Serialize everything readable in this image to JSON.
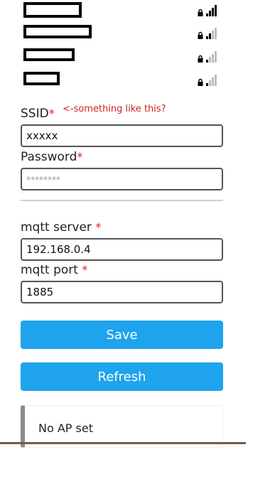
{
  "networks": [
    {
      "name": "",
      "signal_bars_on": 4,
      "signal_bars_total": 4,
      "locked": true
    },
    {
      "name": "",
      "signal_bars_on": 2,
      "signal_bars_total": 4,
      "locked": true
    },
    {
      "name": "",
      "signal_bars_on": 1,
      "signal_bars_total": 4,
      "locked": true
    },
    {
      "name": "",
      "signal_bars_on": 1,
      "signal_bars_total": 4,
      "locked": true
    }
  ],
  "form": {
    "ssid_label": "SSID",
    "ssid_value": "xxxxx",
    "ssid_annotation": "<-something like this?",
    "password_label": "Password",
    "password_placeholder": "********",
    "mqtt_server_label": "mqtt server",
    "mqtt_server_value": "192.168.0.4",
    "mqtt_port_label": "mqtt port",
    "mqtt_port_value": "1885",
    "required_marker": "*"
  },
  "buttons": {
    "save_label": "Save",
    "refresh_label": "Refresh"
  },
  "status": {
    "message": "No AP set"
  },
  "colors": {
    "button": "#1fa3ec",
    "required": "#e01b1b",
    "annotation": "#d02020",
    "status_border": "#8a8a8a"
  },
  "icons": {
    "lock": "lock-icon",
    "signal": "signal-strength-icon"
  }
}
